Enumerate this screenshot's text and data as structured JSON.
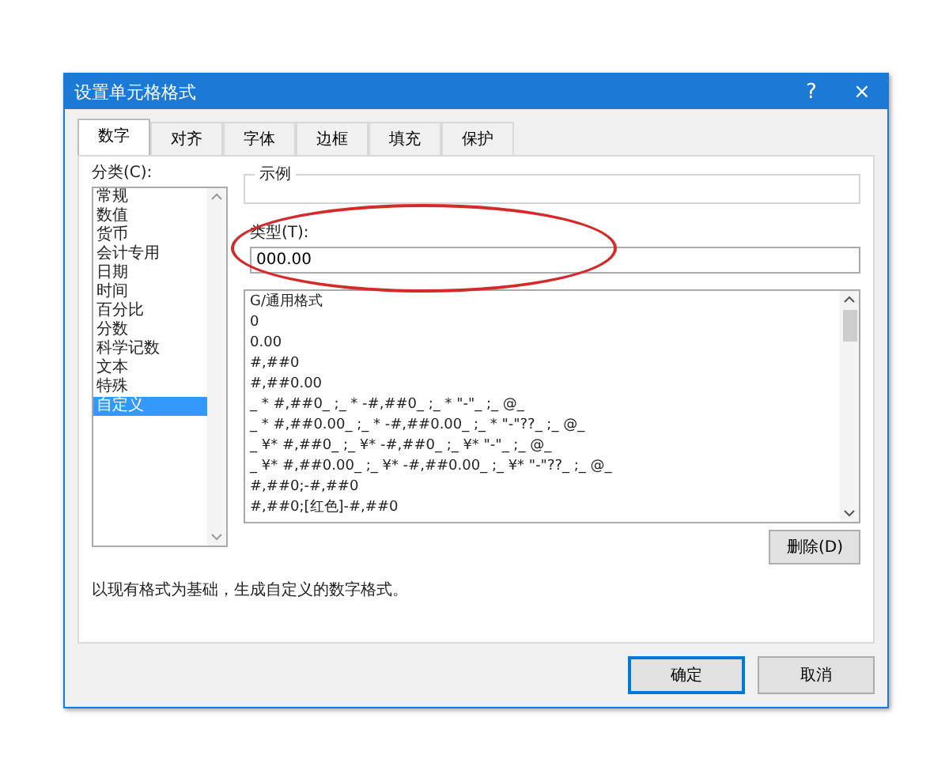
{
  "window": {
    "title": "设置单元格格式",
    "help": "?",
    "close": "×"
  },
  "tabs": [
    {
      "label": "数字",
      "selected": true
    },
    {
      "label": "对齐",
      "selected": false
    },
    {
      "label": "字体",
      "selected": false
    },
    {
      "label": "边框",
      "selected": false
    },
    {
      "label": "填充",
      "selected": false
    },
    {
      "label": "保护",
      "selected": false
    }
  ],
  "category": {
    "label": "分类(C):",
    "items": [
      {
        "label": "常规",
        "selected": false
      },
      {
        "label": "数值",
        "selected": false
      },
      {
        "label": "货币",
        "selected": false
      },
      {
        "label": "会计专用",
        "selected": false
      },
      {
        "label": "日期",
        "selected": false
      },
      {
        "label": "时间",
        "selected": false
      },
      {
        "label": "百分比",
        "selected": false
      },
      {
        "label": "分数",
        "selected": false
      },
      {
        "label": "科学记数",
        "selected": false
      },
      {
        "label": "文本",
        "selected": false
      },
      {
        "label": "特殊",
        "selected": false
      },
      {
        "label": "自定义",
        "selected": true
      }
    ]
  },
  "sample": {
    "label": "示例"
  },
  "type": {
    "label": "类型(T):",
    "value": "000.00",
    "highlighted": true
  },
  "formats": [
    {
      "label": "G/通用格式",
      "selected": false
    },
    {
      "label": "0",
      "selected": false
    },
    {
      "label": "0.00",
      "selected": false
    },
    {
      "label": "#,##0",
      "selected": false
    },
    {
      "label": "#,##0.00",
      "selected": false
    },
    {
      "label": "_ * #,##0_ ;_ * -#,##0_ ;_ * \"-\"_ ;_ @_",
      "selected": false
    },
    {
      "label": "_ * #,##0.00_ ;_ * -#,##0.00_ ;_ * \"-\"??_ ;_ @_",
      "selected": false
    },
    {
      "label": "_ ¥* #,##0_ ;_ ¥* -#,##0_ ;_ ¥* \"-\"_ ;_ @_",
      "selected": false
    },
    {
      "label": "_ ¥* #,##0.00_ ;_ ¥* -#,##0.00_ ;_ ¥* \"-\"??_ ;_ @_",
      "selected": false
    },
    {
      "label": "#,##0;-#,##0",
      "selected": false
    },
    {
      "label": "#,##0;[红色]-#,##0",
      "selected": false
    }
  ],
  "delete_button": "删除(D)",
  "description": "以现有格式为基础，生成自定义的数字格式。",
  "buttons": [
    {
      "label": "确定",
      "default": true
    },
    {
      "label": "取消",
      "default": false
    }
  ]
}
